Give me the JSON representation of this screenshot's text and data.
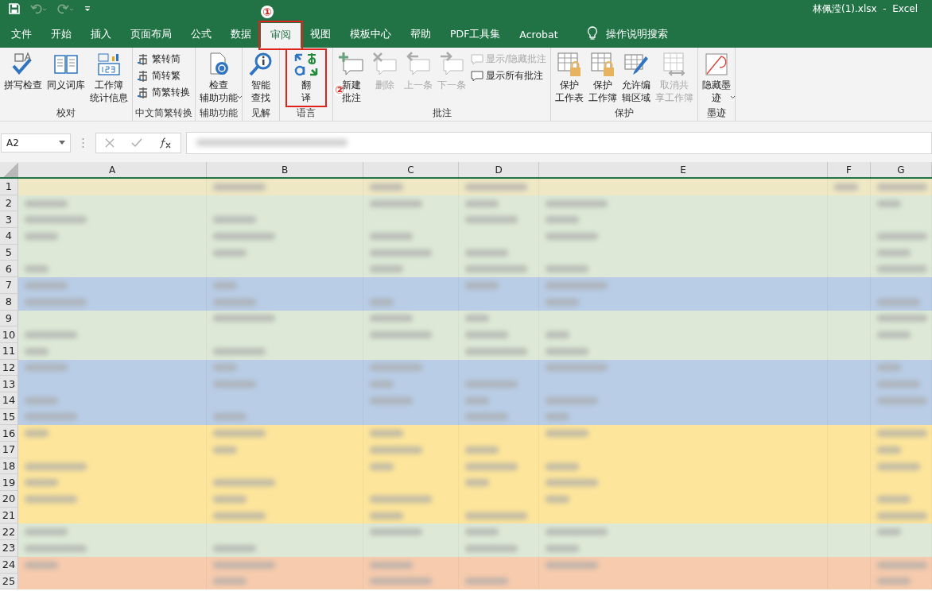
{
  "title": "林佩滢(1).xlsx  -  Excel",
  "tabs": [
    {
      "label": "文件",
      "selected": false
    },
    {
      "label": "开始",
      "selected": false
    },
    {
      "label": "插入",
      "selected": false
    },
    {
      "label": "页面布局",
      "selected": false
    },
    {
      "label": "公式",
      "selected": false
    },
    {
      "label": "数据",
      "selected": false
    },
    {
      "label": "审阅",
      "selected": true,
      "highlighted": true,
      "marker": "①"
    },
    {
      "label": "视图",
      "selected": false
    },
    {
      "label": "模板中心",
      "selected": false
    },
    {
      "label": "帮助",
      "selected": false
    },
    {
      "label": "PDF工具集",
      "selected": false
    },
    {
      "label": "Acrobat",
      "selected": false
    }
  ],
  "tell_me": "操作说明搜索",
  "ribbon_groups": [
    {
      "label": "校对",
      "items": [
        {
          "kind": "large",
          "lines": [
            "拼写检查"
          ],
          "disabled": false
        },
        {
          "kind": "large",
          "lines": [
            "同义词库"
          ],
          "disabled": false
        },
        {
          "kind": "large",
          "lines": [
            "工作簿",
            "统计信息"
          ],
          "disabled": false
        }
      ]
    },
    {
      "label": "中文简繁转换",
      "items": [
        {
          "kind": "small",
          "label": "繁转简",
          "disabled": false
        },
        {
          "kind": "small",
          "label": "简转繁",
          "disabled": false
        },
        {
          "kind": "small",
          "label": "简繁转换",
          "disabled": false
        }
      ]
    },
    {
      "label": "辅助功能",
      "items": [
        {
          "kind": "large",
          "lines": [
            "检查",
            "辅助功能"
          ],
          "dropdown": true,
          "disabled": false
        }
      ]
    },
    {
      "label": "见解",
      "items": [
        {
          "kind": "large",
          "lines": [
            "智能",
            "查找"
          ],
          "disabled": false
        }
      ]
    },
    {
      "label": "语言",
      "items": [
        {
          "kind": "large",
          "lines": [
            "翻",
            "译"
          ],
          "highlighted": true,
          "marker": "②",
          "disabled": false
        }
      ]
    },
    {
      "label": "批注",
      "items": [
        {
          "kind": "large",
          "lines": [
            "新建",
            "批注"
          ],
          "disabled": false
        },
        {
          "kind": "large",
          "lines": [
            "删除"
          ],
          "disabled": true
        },
        {
          "kind": "large",
          "lines": [
            "上一条"
          ],
          "disabled": true
        },
        {
          "kind": "large",
          "lines": [
            "下一条"
          ],
          "disabled": true
        },
        {
          "kind": "small",
          "label": "显示/隐藏批注",
          "disabled": true
        },
        {
          "kind": "small",
          "label": "显示所有批注",
          "disabled": false
        }
      ]
    },
    {
      "label": "保护",
      "items": [
        {
          "kind": "large",
          "lines": [
            "保护",
            "工作表"
          ],
          "disabled": false
        },
        {
          "kind": "large",
          "lines": [
            "保护",
            "工作簿"
          ],
          "disabled": false
        },
        {
          "kind": "large",
          "lines": [
            "允许编",
            "辑区域"
          ],
          "disabled": false
        },
        {
          "kind": "large",
          "lines": [
            "取消共",
            "享工作簿"
          ],
          "disabled": true
        }
      ]
    },
    {
      "label": "墨迹",
      "items": [
        {
          "kind": "large",
          "lines": [
            "隐藏墨",
            "迹"
          ],
          "dropdown": true,
          "disabled": false
        }
      ]
    }
  ],
  "name_box": "A2",
  "columns": [
    "A",
    "B",
    "C",
    "D",
    "E",
    "F",
    "G"
  ],
  "rows": [
    {
      "number": "1",
      "color": "#efe8c4"
    },
    {
      "number": "2",
      "color": "#dde9d6"
    },
    {
      "number": "3",
      "color": "#dde9d6"
    },
    {
      "number": "4",
      "color": "#dde9d6"
    },
    {
      "number": "5",
      "color": "#dde9d6"
    },
    {
      "number": "6",
      "color": "#dde9d6"
    },
    {
      "number": "7",
      "color": "#b9cde6"
    },
    {
      "number": "8",
      "color": "#b9cde6"
    },
    {
      "number": "9",
      "color": "#dde9d6"
    },
    {
      "number": "10",
      "color": "#dde9d6"
    },
    {
      "number": "11",
      "color": "#dde9d6"
    },
    {
      "number": "12",
      "color": "#b9cde6"
    },
    {
      "number": "13",
      "color": "#b9cde6"
    },
    {
      "number": "14",
      "color": "#b9cde6"
    },
    {
      "number": "15",
      "color": "#b9cde6"
    },
    {
      "number": "16",
      "color": "#fde59b"
    },
    {
      "number": "17",
      "color": "#fde59b"
    },
    {
      "number": "18",
      "color": "#fde59b"
    },
    {
      "number": "19",
      "color": "#fde59b"
    },
    {
      "number": "20",
      "color": "#fde59b"
    },
    {
      "number": "21",
      "color": "#fde59b"
    },
    {
      "number": "22",
      "color": "#dde9d6"
    },
    {
      "number": "23",
      "color": "#dde9d6"
    },
    {
      "number": "24",
      "color": "#f7cbad"
    },
    {
      "number": "25",
      "color": "#f7cbad"
    }
  ]
}
